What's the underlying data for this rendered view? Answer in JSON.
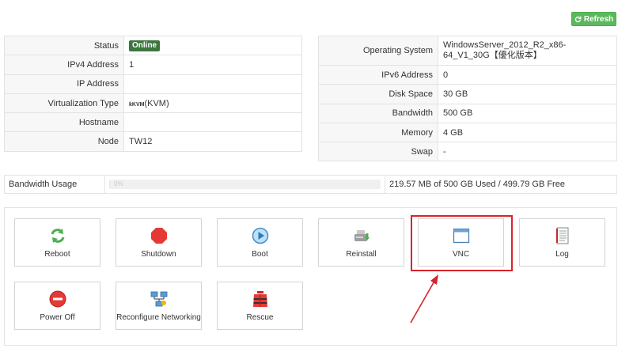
{
  "toolbar": {
    "refresh_label": "Refresh"
  },
  "left_table": [
    {
      "label": "Status",
      "value": "Online",
      "type": "badge"
    },
    {
      "label": "IPv4 Address",
      "value": "1"
    },
    {
      "label": "IP Address",
      "value": ""
    },
    {
      "label": "Virtualization Type",
      "prefix": "ƙKVM",
      "value": "(KVM)",
      "type": "kvm"
    },
    {
      "label": "Hostname",
      "value": ""
    },
    {
      "label": "Node",
      "value": "TW12"
    }
  ],
  "right_table": [
    {
      "label": "Operating System",
      "value": "WindowsServer_2012_R2_x86-64_V1_30G【優化版本】"
    },
    {
      "label": "IPv6 Address",
      "value": "0"
    },
    {
      "label": "Disk Space",
      "value": "30 GB"
    },
    {
      "label": "Bandwidth",
      "value": "500 GB"
    },
    {
      "label": "Memory",
      "value": "4 GB"
    },
    {
      "label": "Swap",
      "value": "-"
    }
  ],
  "bandwidth": {
    "label": "Bandwidth Usage",
    "percent_text": "0%",
    "used_fraction": 0.0004,
    "summary": "219.57 MB of 500 GB Used / 499.79 GB Free"
  },
  "actions": [
    {
      "id": "reboot",
      "label": "Reboot",
      "icon": "reboot-icon"
    },
    {
      "id": "shutdown",
      "label": "Shutdown",
      "icon": "shutdown-icon"
    },
    {
      "id": "boot",
      "label": "Boot",
      "icon": "boot-icon"
    },
    {
      "id": "reinstall",
      "label": "Reinstall",
      "icon": "reinstall-icon"
    },
    {
      "id": "vnc",
      "label": "VNC",
      "icon": "vnc-icon"
    },
    {
      "id": "log",
      "label": "Log",
      "icon": "log-icon"
    },
    {
      "id": "power-off",
      "label": "Power Off",
      "icon": "power-off-icon"
    },
    {
      "id": "reconfigure-networking",
      "label": "Reconfigure Networking",
      "icon": "network-icon"
    },
    {
      "id": "rescue",
      "label": "Rescue",
      "icon": "rescue-icon"
    }
  ],
  "colors": {
    "accent_green": "#5cb85c",
    "badge_green": "#3c763d",
    "highlight_red": "#d9232d"
  }
}
